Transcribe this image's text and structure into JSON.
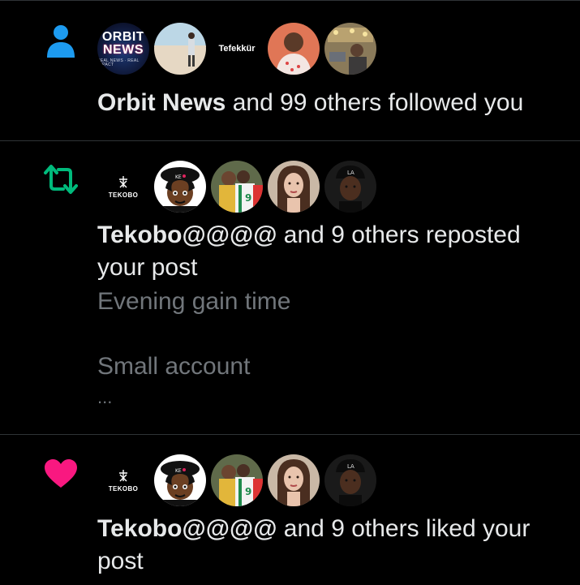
{
  "notifications": [
    {
      "type": "follow",
      "icon": "person-icon",
      "icon_color": "#1d9bf0",
      "avatars": [
        {
          "kind": "orbit-logo",
          "title": "ORBIT",
          "title2": "NEWS",
          "tagline": "REAL NEWS · REAL IMPACT"
        },
        {
          "kind": "photo-beach"
        },
        {
          "kind": "text-logo",
          "label": "Tefekkür"
        },
        {
          "kind": "photo-man-pink"
        },
        {
          "kind": "photo-cafe"
        }
      ],
      "actor": "Orbit News",
      "message": " and 99 others followed you"
    },
    {
      "type": "repost",
      "icon": "repost-icon",
      "icon_color": "#00ba7c",
      "avatars": [
        {
          "kind": "tekobo-logo",
          "label": "TEKOBO"
        },
        {
          "kind": "cartoon-avatar"
        },
        {
          "kind": "photo-soccer"
        },
        {
          "kind": "photo-woman"
        },
        {
          "kind": "photo-man-cap"
        }
      ],
      "actor": "Tekobo@@@@",
      "message": " and 9 others reposted your post",
      "post_preview": [
        "Evening gain time",
        "",
        "Small account",
        "..."
      ]
    },
    {
      "type": "like",
      "icon": "heart-icon",
      "icon_color": "#f91880",
      "avatars": [
        {
          "kind": "tekobo-logo",
          "label": "TEKOBO"
        },
        {
          "kind": "cartoon-avatar"
        },
        {
          "kind": "photo-soccer"
        },
        {
          "kind": "photo-woman"
        },
        {
          "kind": "photo-man-cap"
        }
      ],
      "actor": "Tekobo@@@@",
      "message": " and 9 others liked your post"
    }
  ]
}
